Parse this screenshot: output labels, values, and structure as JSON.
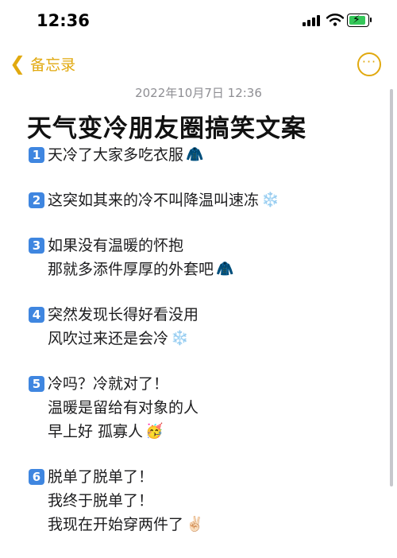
{
  "status_bar": {
    "time": "12:36"
  },
  "nav": {
    "back_label": "备忘录",
    "more_label": "···"
  },
  "note": {
    "date": "2022年10月7日 12:36",
    "title": "天气变冷朋友圈搞笑文案",
    "items": [
      {
        "number": "1",
        "lines": [
          "天冷了大家多吃衣服"
        ],
        "emoji": "🧥"
      },
      {
        "number": "2",
        "lines": [
          "这突如其来的冷不叫降温叫速冻"
        ],
        "emoji": "❄️"
      },
      {
        "number": "3",
        "lines": [
          "如果没有温暖的怀抱",
          "那就多添件厚厚的外套吧"
        ],
        "emoji": "🧥"
      },
      {
        "number": "4",
        "lines": [
          "突然发现长得好看没用",
          "风吹过来还是会冷"
        ],
        "emoji": "❄️"
      },
      {
        "number": "5",
        "lines": [
          "冷吗？冷就对了！",
          "温暖是留给有对象的人",
          "早上好 孤寡人"
        ],
        "emoji": "🥳"
      },
      {
        "number": "6",
        "lines": [
          "脱单了脱单了！",
          "我终于脱单了！",
          "我现在开始穿两件了"
        ],
        "emoji": "✌🏻"
      }
    ]
  },
  "colors": {
    "accent": "#e1a90f",
    "number_badge": "#3f86e0",
    "battery": "#34c759"
  }
}
